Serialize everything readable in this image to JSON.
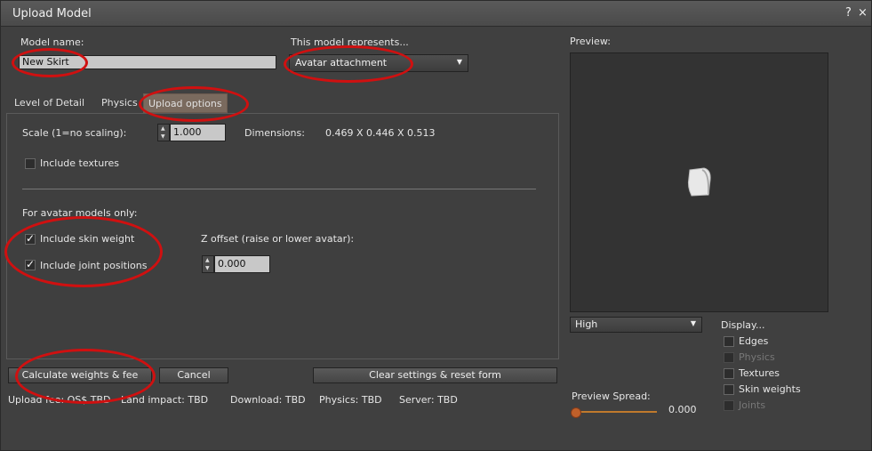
{
  "window": {
    "title": "Upload Model",
    "help": "?",
    "close": "×"
  },
  "model_name": {
    "label": "Model name:",
    "value": "New Skirt"
  },
  "represents": {
    "label": "This model represents...",
    "selected": "Avatar attachment"
  },
  "tabs": [
    {
      "label": "Level of Detail"
    },
    {
      "label": "Physics"
    },
    {
      "label": "Upload options",
      "active": true
    }
  ],
  "upload_options": {
    "scale_label": "Scale (1=no scaling):",
    "scale_value": "1.000",
    "dimensions_label": "Dimensions:",
    "dimensions_value": "0.469 X 0.446 X 0.513",
    "include_textures": {
      "label": "Include textures",
      "checked": false
    },
    "avatar_header": "For avatar models only:",
    "include_skin_weight": {
      "label": "Include skin weight",
      "checked": true
    },
    "include_joint_positions": {
      "label": "Include joint positions",
      "checked": true
    },
    "z_offset_label": "Z offset (raise or lower avatar):",
    "z_offset_value": "0.000"
  },
  "buttons": {
    "calculate": "Calculate weights & fee",
    "cancel": "Cancel",
    "clear": "Clear settings & reset form"
  },
  "status": {
    "upload_fee": "Upload fee: OS$ TBD",
    "land_impact": "Land impact: TBD",
    "download": "Download: TBD",
    "physics": "Physics: TBD",
    "server": "Server: TBD"
  },
  "preview": {
    "label": "Preview:",
    "quality": "High",
    "display_label": "Display...",
    "options": [
      {
        "label": "Edges",
        "checked": false,
        "enabled": true
      },
      {
        "label": "Physics",
        "checked": false,
        "enabled": false
      },
      {
        "label": "Textures",
        "checked": false,
        "enabled": true
      },
      {
        "label": "Skin weights",
        "checked": false,
        "enabled": true
      },
      {
        "label": "Joints",
        "checked": false,
        "enabled": false
      }
    ],
    "spread_label": "Preview Spread:",
    "spread_value": "0.000"
  },
  "colors": {
    "annotation": "#d01010",
    "active_tab": "#7a6a5e",
    "slider": "#c07a2c"
  }
}
